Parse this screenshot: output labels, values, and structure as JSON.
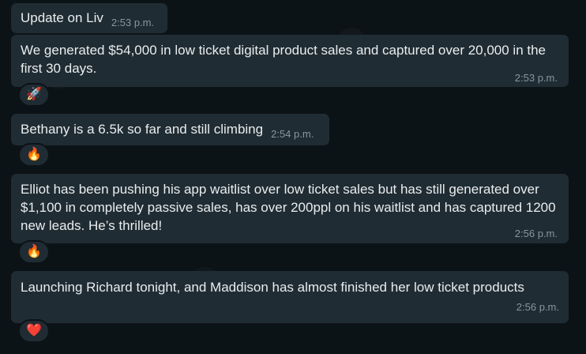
{
  "messages": [
    {
      "text": "Update on Liv",
      "time": "2:53 p.m."
    },
    {
      "text": "We generated $54,000 in low ticket digital product sales and captured over 20,000 in the first 30 days.",
      "time": "2:53 p.m.",
      "reaction": "🚀"
    },
    {
      "text": "Bethany is a 6.5k so far and still climbing",
      "time": "2:54 p.m.",
      "reaction": "🔥"
    },
    {
      "text": "Elliot has been pushing his app waitlist over low ticket sales but has still generated over $1,100 in completely passive sales, has over 200ppl on his waitlist and has captured 1200 new leads. He’s thrilled!",
      "time": "2:56 p.m.",
      "reaction": "🔥"
    },
    {
      "text": "Launching Richard tonight, and Maddison has almost finished her low ticket products",
      "time": "2:56 p.m.",
      "reaction": "❤️"
    }
  ]
}
